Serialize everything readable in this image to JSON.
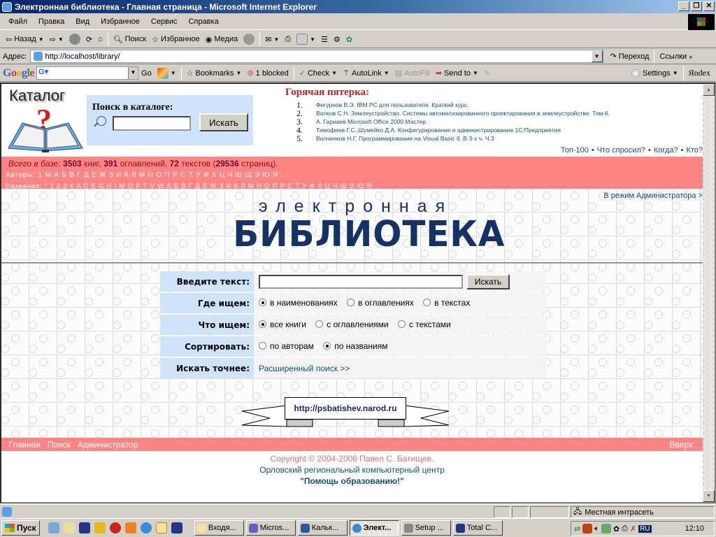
{
  "window": {
    "title": "Электронная библиотека - Главная страница - Microsoft Internet Explorer",
    "controls": [
      "_",
      "❐",
      "✕"
    ]
  },
  "menu": [
    "Файл",
    "Правка",
    "Вид",
    "Избранное",
    "Сервис",
    "Справка"
  ],
  "toolbar": {
    "back": "Назад",
    "search": "Поиск",
    "favorites": "Избранное",
    "media": "Медиа"
  },
  "address": {
    "label": "Адрес:",
    "url": "http://localhost/library/",
    "go": "Переход",
    "links": "Ссылки"
  },
  "google_toolbar": {
    "logo": "Google",
    "go": "Go",
    "bookmarks": "Bookmarks",
    "blocked": "1 blocked",
    "check": "Check",
    "autolink": "AutoLink",
    "autofill": "AutoFill",
    "sendto": "Send to",
    "settings": "Settings",
    "yandex": "Яndex"
  },
  "catalog": {
    "logo_text": "Каталог",
    "search_label": "Поиск в каталоге:",
    "search_value": "",
    "search_button": "Искать"
  },
  "hot": {
    "title": "Горячая пятерка:",
    "items": [
      {
        "n": "1.",
        "text": "Фигурнов В.Э. IBM PC для пользователя. Краткий курс."
      },
      {
        "n": "2.",
        "text": "Волков С.Н. Землеустройство. Системы автоматизированного проектирования в землеустройстве. Том 6."
      },
      {
        "n": "3.",
        "text": "А. Гарнаев Microsoft Office 2000 Мастер"
      },
      {
        "n": "4.",
        "text": "Тимофеев Г.С.,Шумейко Д.А. Конфигурирование и администрирование 1С:Предприятия"
      },
      {
        "n": "5.",
        "text": "Волченков Н.Г. Программирование на Visual Basic 6 .В 3-х ч. Ч.3"
      }
    ]
  },
  "toplinks": [
    "Топ-100",
    "Что спросил?",
    "Когда?",
    "Кто?"
  ],
  "stats": {
    "prefix": "Всего в базе:",
    "books": "3503",
    "books_label": "книг,",
    "toc": "391",
    "toc_label": "оглавлений,",
    "texts": "72",
    "texts_label": "текстов (",
    "pages": "29536",
    "pages_label": "страниц)."
  },
  "authors_index": "Авторы: 1 M А Б В Г Д Е Ж З И К Л М Н О П Р С Т У Ф Х Ц Ч Ш Щ Э Ю Я",
  "titles_index": "Названия: \" 1 2 3 4 A C E G H I M O P T V W А Б В Г Д Е Ж З И К Л М Н О П Р С Т У Ф Х Ц Ч Ш Э Ю Я",
  "admin_link": "В режим Администратора >",
  "brand": {
    "line1": "электронная",
    "line2": "БИБЛИОТЕКА"
  },
  "form": {
    "text_label": "Введите текст:",
    "text_value": "",
    "search_button": "Искать",
    "where_label": "Где ищем:",
    "where_options": [
      {
        "label": "в наименованиях",
        "checked": true
      },
      {
        "label": "в оглавлениях",
        "checked": false
      },
      {
        "label": "в текстах",
        "checked": false
      }
    ],
    "what_label": "Что ищем:",
    "what_options": [
      {
        "label": "все книги",
        "checked": true
      },
      {
        "label": "с оглавлениями",
        "checked": false
      },
      {
        "label": "с текстами",
        "checked": false
      }
    ],
    "sort_label": "Сортировать:",
    "sort_options": [
      {
        "label": "по авторам",
        "checked": false
      },
      {
        "label": "по названиям",
        "checked": true
      }
    ],
    "precise_label": "Искать точнее:",
    "advanced_link": "Расширенный поиск >>"
  },
  "ribbon_url": "http://psbatishev.narod.ru",
  "bottom_nav": [
    "Главная",
    "Поиск",
    "Администратор"
  ],
  "up_link": "Вверх",
  "footer": {
    "copyright": "Copyright © 2004-2006 Павел С. Батищев.",
    "org": "Орловский региональный компьютерный центр",
    "slogan": "\"Помощь образованию!\""
  },
  "statusbar": {
    "zone": "Местная интрасеть"
  },
  "taskbar": {
    "start": "Пуск",
    "tasks": [
      {
        "label": "Входя...",
        "active": false
      },
      {
        "label": "Micros...",
        "active": false
      },
      {
        "label": "Кальк...",
        "active": false
      },
      {
        "label": "Элект...",
        "active": true
      },
      {
        "label": "Setup ...",
        "active": false
      },
      {
        "label": "Total C...",
        "active": false
      }
    ],
    "lang": "RU",
    "clock": "12:10"
  },
  "colors": {
    "pink_bar": "#ff8484",
    "light_blue": "#cfe4fa",
    "link": "#14506e",
    "brand_navy": "#143264",
    "hot_title": "#c81e1e"
  }
}
